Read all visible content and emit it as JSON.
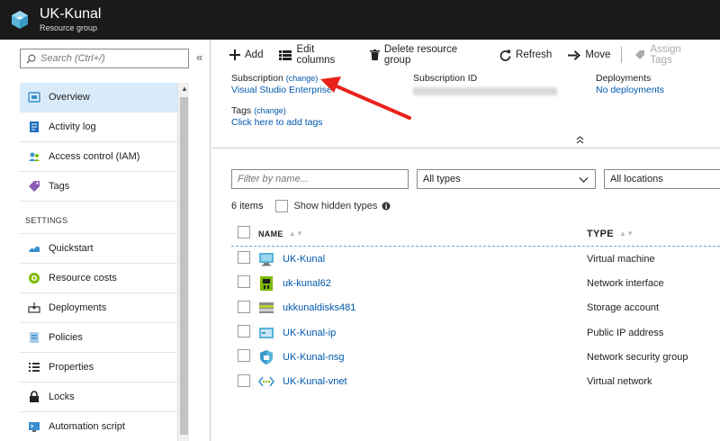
{
  "header": {
    "title": "UK-Kunal",
    "subtitle": "Resource group",
    "colors": {
      "bg": "#1a1a1a",
      "logo": "#59b4d9"
    }
  },
  "sidebar": {
    "search_placeholder": "Search (Ctrl+/)",
    "collapse_glyph": "«",
    "items": [
      {
        "label": "Overview",
        "icon": "overview-icon",
        "active": true
      },
      {
        "label": "Activity log",
        "icon": "activity-log-icon"
      },
      {
        "label": "Access control (IAM)",
        "icon": "iam-icon"
      },
      {
        "label": "Tags",
        "icon": "tag-icon"
      }
    ],
    "settings_label": "SETTINGS",
    "settings_items": [
      {
        "label": "Quickstart",
        "icon": "quickstart-icon"
      },
      {
        "label": "Resource costs",
        "icon": "resource-costs-icon"
      },
      {
        "label": "Deployments",
        "icon": "deployments-icon"
      },
      {
        "label": "Policies",
        "icon": "policies-icon"
      },
      {
        "label": "Properties",
        "icon": "properties-icon"
      },
      {
        "label": "Locks",
        "icon": "lock-icon"
      },
      {
        "label": "Automation script",
        "icon": "automation-script-icon"
      }
    ]
  },
  "toolbar": {
    "add": "Add",
    "edit_columns": "Edit columns",
    "delete_group": "Delete resource group",
    "refresh": "Refresh",
    "move": "Move",
    "assign_tags": "Assign Tags"
  },
  "essentials": {
    "subscription_label": "Subscription",
    "subscription_change": "(change)",
    "subscription_value": "Visual Studio Enterprise",
    "subscription_id_label": "Subscription ID",
    "deployments_label": "Deployments",
    "deployments_value": "No deployments",
    "tags_label": "Tags",
    "tags_change": "(change)",
    "tags_link": "Click here to add tags",
    "collapse_glyph": "⌃"
  },
  "filters": {
    "name_placeholder": "Filter by name...",
    "types_value": "All types",
    "locations_value": "All locations"
  },
  "list": {
    "items_count": "6 items",
    "show_hidden": "Show hidden types",
    "col_name": "NAME",
    "col_type": "TYPE",
    "rows": [
      {
        "name": "UK-Kunal",
        "type": "Virtual machine",
        "icon": "virtual-machine-icon"
      },
      {
        "name": "uk-kunal62",
        "type": "Network interface",
        "icon": "network-interface-icon"
      },
      {
        "name": "ukkunaldisks481",
        "type": "Storage account",
        "icon": "storage-account-icon"
      },
      {
        "name": "UK-Kunal-ip",
        "type": "Public IP address",
        "icon": "public-ip-icon"
      },
      {
        "name": "UK-Kunal-nsg",
        "type": "Network security group",
        "icon": "nsg-shield-icon"
      },
      {
        "name": "UK-Kunal-vnet",
        "type": "Virtual network",
        "icon": "vnet-icon"
      }
    ]
  },
  "colors": {
    "link": "#0058ad",
    "active_bg": "#d9ebf9",
    "annotation": "#e8221b"
  }
}
